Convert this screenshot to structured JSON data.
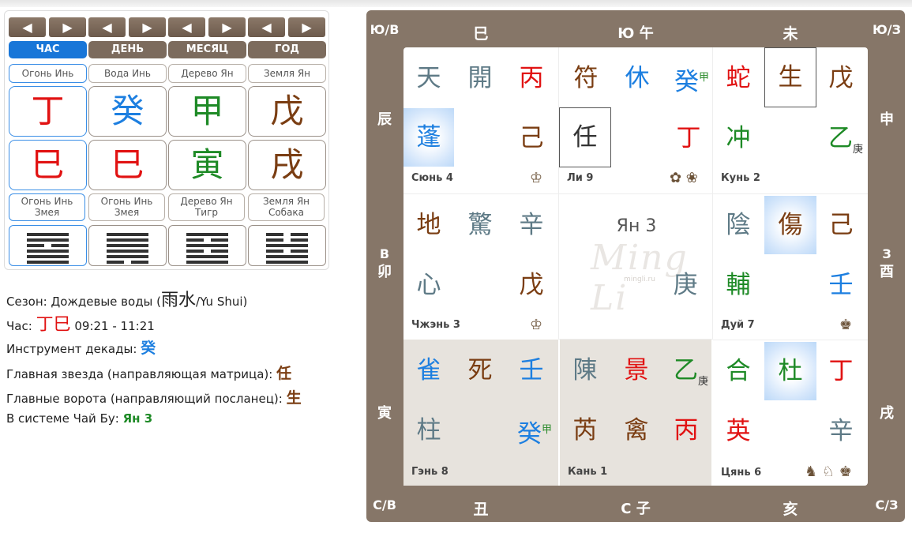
{
  "nav": {
    "prev": "◀",
    "next": "▶"
  },
  "pillars": [
    {
      "label": "ЧАС",
      "element_top": "Огонь Инь",
      "stem": "丁",
      "stem_color": "#e11212",
      "branch": "巳",
      "branch_color": "#e11212",
      "element_bottom_1": "Огонь Инь",
      "element_bottom_2": "Змея",
      "active": true
    },
    {
      "label": "ДЕНЬ",
      "element_top": "Вода Инь",
      "stem": "癸",
      "stem_color": "#1d7fe0",
      "branch": "巳",
      "branch_color": "#e11212",
      "element_bottom_1": "Огонь Инь",
      "element_bottom_2": "Змея",
      "active": false
    },
    {
      "label": "МЕСЯЦ",
      "element_top": "Дерево Ян",
      "stem": "甲",
      "stem_color": "#1e8a26",
      "branch": "寅",
      "branch_color": "#1e8a26",
      "element_bottom_1": "Дерево Ян",
      "element_bottom_2": "Тигр",
      "active": false
    },
    {
      "label": "ГОД",
      "element_top": "Земля Ян",
      "stem": "戊",
      "stem_color": "#7a3d12",
      "branch": "戌",
      "branch_color": "#7a3d12",
      "element_bottom_1": "Земля Ян",
      "element_bottom_2": "Собака",
      "active": false
    }
  ],
  "info": {
    "season_label": "Сезон: Дождевые воды (",
    "season_chars": "雨水",
    "season_tail": "/Yu Shui)",
    "hour_label": "Час:",
    "hour_stem": "丁",
    "hour_branch": "巳",
    "hour_time": "09:21 - 11:21",
    "decade_label": "Инструмент декады:",
    "decade_value": "癸",
    "star_label": "Главная звезда (направляющая матрица):",
    "star_value": "任",
    "gate_label": "Главные ворота (направляющий посланец):",
    "gate_value": "生",
    "chaibu_label": "В системе Чай Бу:",
    "chaibu_value": "Ян 3"
  },
  "chart": {
    "corners": {
      "tl": "Ю/В",
      "tr": "Ю/З",
      "bl": "С/В",
      "br": "С/З"
    },
    "top": [
      "巳",
      "Ю 午",
      "未"
    ],
    "bottom": [
      "丑",
      "С 子",
      "亥"
    ],
    "left": [
      "辰",
      "В",
      "卯",
      "寅"
    ],
    "right": [
      "申",
      "З",
      "酉",
      "戌"
    ],
    "center": {
      "title": "Ян 3",
      "watermark": "Ming Li",
      "watermark_url": "mingli.ru"
    },
    "palaces": {
      "xun": {
        "name": "Сюнь 4",
        "r1": [
          "天",
          "開",
          "丙"
        ],
        "r2": [
          "蓬",
          "",
          "己"
        ],
        "icons": "♔"
      },
      "li": {
        "name": "Ли 9",
        "r1": [
          "符",
          "休",
          "癸"
        ],
        "r1_sup": "甲",
        "r2": [
          "任",
          "",
          "丁"
        ],
        "icons": "✿ ❀"
      },
      "kun": {
        "name": "Кунь 2",
        "r1": [
          "蛇",
          "生",
          "戊"
        ],
        "r2": [
          "冲",
          "",
          "乙"
        ],
        "r2_sub": "庚"
      },
      "zhen": {
        "name": "Чжэнь 3",
        "r1": [
          "地",
          "驚",
          "辛"
        ],
        "r2": [
          "心",
          "",
          "戊"
        ],
        "icons": "♔"
      },
      "dui": {
        "name": "Дуй 7",
        "r1": [
          "陰",
          "傷",
          "己"
        ],
        "r2": [
          "輔",
          "",
          "壬"
        ],
        "icons": "♚"
      },
      "gen": {
        "name": "Гэнь 8",
        "r1": [
          "雀",
          "死",
          "壬"
        ],
        "r2": [
          "柱",
          "",
          "癸"
        ],
        "r2_sup": "甲"
      },
      "kan": {
        "name": "Кань 1",
        "r1": [
          "陳",
          "景",
          "乙"
        ],
        "r1_sub": "庚",
        "r2": [
          "芮",
          "禽",
          "丙"
        ]
      },
      "qian": {
        "name": "Цянь 6",
        "r1": [
          "合",
          "杜",
          "丁"
        ],
        "r2": [
          "英",
          "",
          "辛"
        ],
        "icons": "♞ ♘ ♚"
      }
    }
  }
}
